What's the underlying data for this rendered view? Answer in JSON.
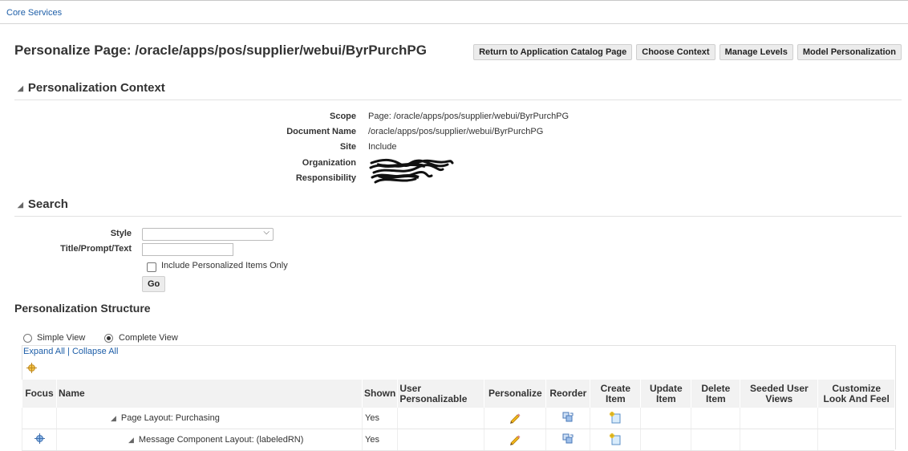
{
  "header": {
    "brand": "Core Services"
  },
  "page": {
    "title": "Personalize Page: /oracle/apps/pos/supplier/webui/ByrPurchPG",
    "buttons": [
      "Return to Application Catalog Page",
      "Choose Context",
      "Manage Levels",
      "Model Personalization"
    ]
  },
  "context": {
    "heading": "Personalization Context",
    "rows": [
      {
        "label": "Scope",
        "value": "Page: /oracle/apps/pos/supplier/webui/ByrPurchPG"
      },
      {
        "label": "Document Name",
        "value": "/oracle/apps/pos/supplier/webui/ByrPurchPG"
      },
      {
        "label": "Site",
        "value": "Include"
      },
      {
        "label": "Organization",
        "value": ""
      },
      {
        "label": "Responsibility",
        "value": ""
      }
    ]
  },
  "search": {
    "heading": "Search",
    "style_label": "Style",
    "style_value": "",
    "title_label": "Title/Prompt/Text",
    "title_value": "",
    "checkbox_label": "Include Personalized Items Only",
    "go_label": "Go"
  },
  "structure": {
    "heading": "Personalization Structure",
    "simple_view": "Simple View",
    "complete_view": "Complete View",
    "selected_view": "Complete View",
    "expand_all": "Expand All",
    "separator": "|",
    "collapse_all": "Collapse All",
    "columns": [
      "Focus",
      "Name",
      "Shown",
      "User Personalizable",
      "Personalize",
      "Reorder",
      "Create Item",
      "Update Item",
      "Delete Item",
      "Seeded User Views",
      "Customize Look And Feel"
    ],
    "rows": [
      {
        "focus": false,
        "name": "Page Layout: Purchasing",
        "shown": "Yes",
        "user_personalizable": "",
        "personalize": "pencil-icon",
        "reorder": "reorder-icon",
        "create": "create-item-icon"
      },
      {
        "focus": true,
        "name": "Message Component Layout: (labeledRN)",
        "shown": "Yes",
        "user_personalizable": "",
        "personalize": "pencil-icon",
        "reorder": "reorder-icon",
        "create": "create-item-icon"
      }
    ]
  }
}
